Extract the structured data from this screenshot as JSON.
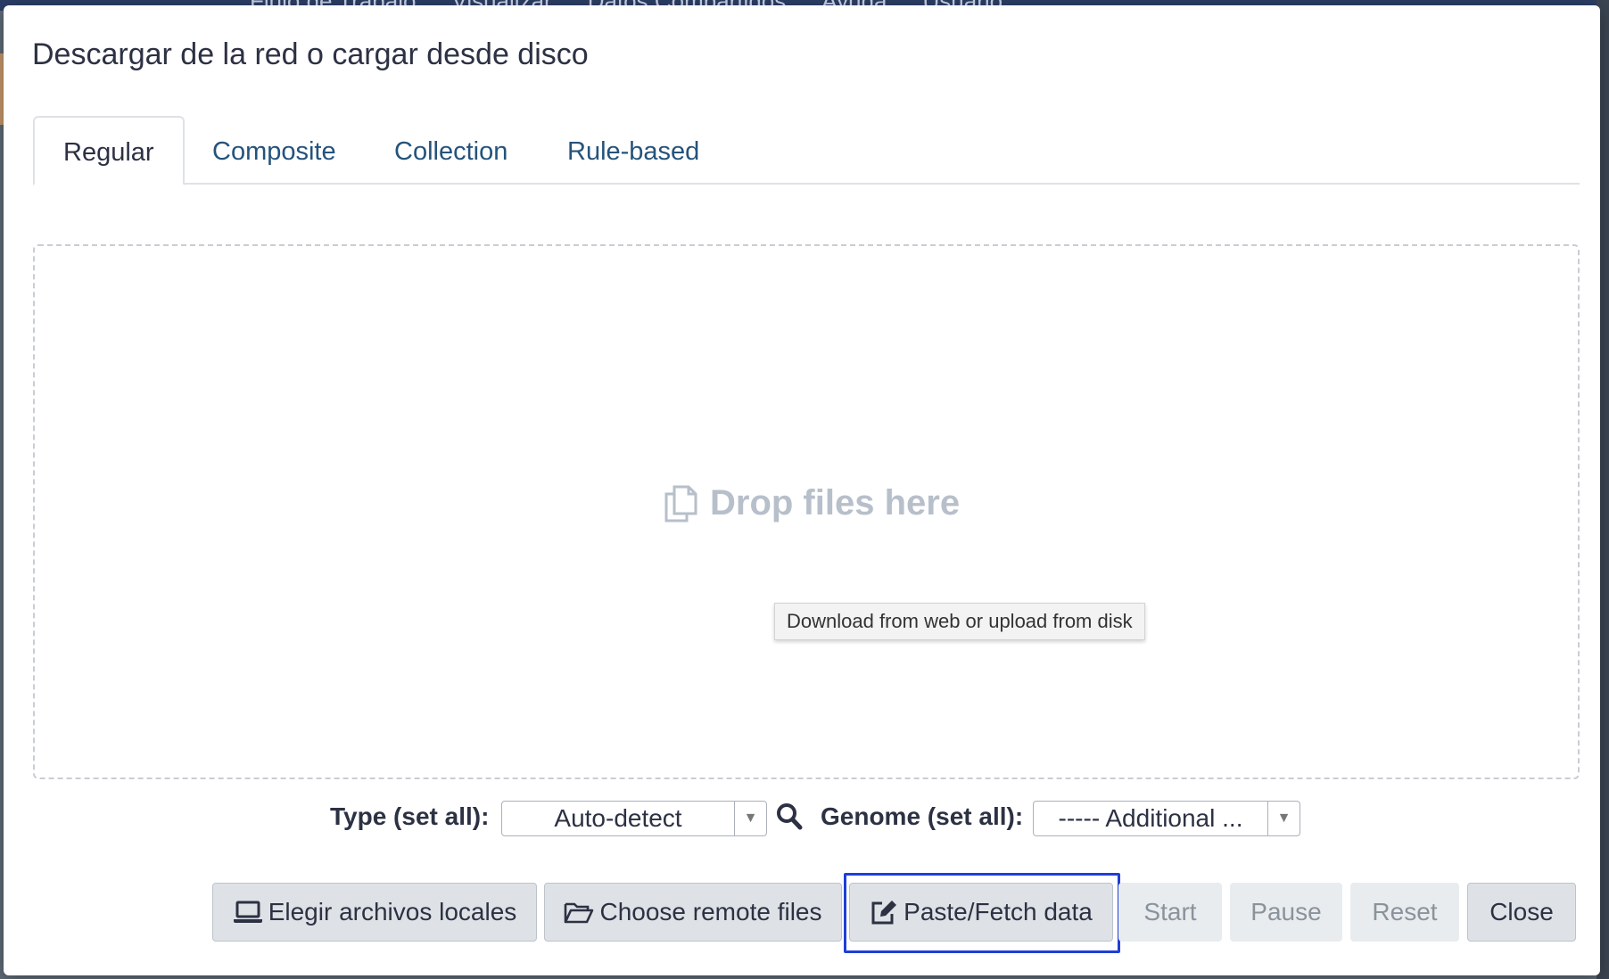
{
  "background": {
    "nav_items": [
      "Flujo de Trabajo",
      "Visualizar",
      "Datos Compartidos",
      "Ayuda",
      "Usuario"
    ]
  },
  "modal": {
    "title": "Descargar de la red o cargar desde disco"
  },
  "tabs": [
    {
      "label": "Regular",
      "active": true
    },
    {
      "label": "Composite",
      "active": false
    },
    {
      "label": "Collection",
      "active": false
    },
    {
      "label": "Rule-based",
      "active": false
    }
  ],
  "dropzone": {
    "label": "Drop files here",
    "icon": "copy-files-icon"
  },
  "tooltip": {
    "text": "Download from web or upload from disk"
  },
  "settings": {
    "type_label": "Type (set all):",
    "type_value": "Auto-detect",
    "genome_label": "Genome (set all):",
    "genome_value": "----- Additional ..."
  },
  "buttons": {
    "local": "Elegir archivos locales",
    "remote": "Choose remote files",
    "paste": "Paste/Fetch data",
    "start": "Start",
    "pause": "Pause",
    "reset": "Reset",
    "close": "Close"
  },
  "colors": {
    "tab_link": "#25537b",
    "highlight": "#1f3fd6",
    "drop_text": "#b7bfca"
  }
}
